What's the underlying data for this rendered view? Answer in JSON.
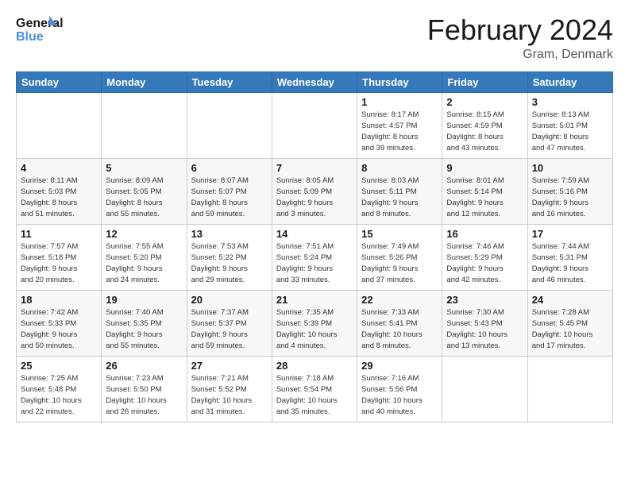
{
  "logo": {
    "line1": "General",
    "line2": "Blue"
  },
  "title": "February 2024",
  "location": "Gram, Denmark",
  "days_of_week": [
    "Sunday",
    "Monday",
    "Tuesday",
    "Wednesday",
    "Thursday",
    "Friday",
    "Saturday"
  ],
  "weeks": [
    [
      {
        "day": "",
        "info": ""
      },
      {
        "day": "",
        "info": ""
      },
      {
        "day": "",
        "info": ""
      },
      {
        "day": "",
        "info": ""
      },
      {
        "day": "1",
        "info": "Sunrise: 8:17 AM\nSunset: 4:57 PM\nDaylight: 8 hours\nand 39 minutes."
      },
      {
        "day": "2",
        "info": "Sunrise: 8:15 AM\nSunset: 4:59 PM\nDaylight: 8 hours\nand 43 minutes."
      },
      {
        "day": "3",
        "info": "Sunrise: 8:13 AM\nSunset: 5:01 PM\nDaylight: 8 hours\nand 47 minutes."
      }
    ],
    [
      {
        "day": "4",
        "info": "Sunrise: 8:11 AM\nSunset: 5:03 PM\nDaylight: 8 hours\nand 51 minutes."
      },
      {
        "day": "5",
        "info": "Sunrise: 8:09 AM\nSunset: 5:05 PM\nDaylight: 8 hours\nand 55 minutes."
      },
      {
        "day": "6",
        "info": "Sunrise: 8:07 AM\nSunset: 5:07 PM\nDaylight: 8 hours\nand 59 minutes."
      },
      {
        "day": "7",
        "info": "Sunrise: 8:05 AM\nSunset: 5:09 PM\nDaylight: 9 hours\nand 3 minutes."
      },
      {
        "day": "8",
        "info": "Sunrise: 8:03 AM\nSunset: 5:11 PM\nDaylight: 9 hours\nand 8 minutes."
      },
      {
        "day": "9",
        "info": "Sunrise: 8:01 AM\nSunset: 5:14 PM\nDaylight: 9 hours\nand 12 minutes."
      },
      {
        "day": "10",
        "info": "Sunrise: 7:59 AM\nSunset: 5:16 PM\nDaylight: 9 hours\nand 16 minutes."
      }
    ],
    [
      {
        "day": "11",
        "info": "Sunrise: 7:57 AM\nSunset: 5:18 PM\nDaylight: 9 hours\nand 20 minutes."
      },
      {
        "day": "12",
        "info": "Sunrise: 7:55 AM\nSunset: 5:20 PM\nDaylight: 9 hours\nand 24 minutes."
      },
      {
        "day": "13",
        "info": "Sunrise: 7:53 AM\nSunset: 5:22 PM\nDaylight: 9 hours\nand 29 minutes."
      },
      {
        "day": "14",
        "info": "Sunrise: 7:51 AM\nSunset: 5:24 PM\nDaylight: 9 hours\nand 33 minutes."
      },
      {
        "day": "15",
        "info": "Sunrise: 7:49 AM\nSunset: 5:26 PM\nDaylight: 9 hours\nand 37 minutes."
      },
      {
        "day": "16",
        "info": "Sunrise: 7:46 AM\nSunset: 5:29 PM\nDaylight: 9 hours\nand 42 minutes."
      },
      {
        "day": "17",
        "info": "Sunrise: 7:44 AM\nSunset: 5:31 PM\nDaylight: 9 hours\nand 46 minutes."
      }
    ],
    [
      {
        "day": "18",
        "info": "Sunrise: 7:42 AM\nSunset: 5:33 PM\nDaylight: 9 hours\nand 50 minutes."
      },
      {
        "day": "19",
        "info": "Sunrise: 7:40 AM\nSunset: 5:35 PM\nDaylight: 9 hours\nand 55 minutes."
      },
      {
        "day": "20",
        "info": "Sunrise: 7:37 AM\nSunset: 5:37 PM\nDaylight: 9 hours\nand 59 minutes."
      },
      {
        "day": "21",
        "info": "Sunrise: 7:35 AM\nSunset: 5:39 PM\nDaylight: 10 hours\nand 4 minutes."
      },
      {
        "day": "22",
        "info": "Sunrise: 7:33 AM\nSunset: 5:41 PM\nDaylight: 10 hours\nand 8 minutes."
      },
      {
        "day": "23",
        "info": "Sunrise: 7:30 AM\nSunset: 5:43 PM\nDaylight: 10 hours\nand 13 minutes."
      },
      {
        "day": "24",
        "info": "Sunrise: 7:28 AM\nSunset: 5:45 PM\nDaylight: 10 hours\nand 17 minutes."
      }
    ],
    [
      {
        "day": "25",
        "info": "Sunrise: 7:25 AM\nSunset: 5:48 PM\nDaylight: 10 hours\nand 22 minutes."
      },
      {
        "day": "26",
        "info": "Sunrise: 7:23 AM\nSunset: 5:50 PM\nDaylight: 10 hours\nand 26 minutes."
      },
      {
        "day": "27",
        "info": "Sunrise: 7:21 AM\nSunset: 5:52 PM\nDaylight: 10 hours\nand 31 minutes."
      },
      {
        "day": "28",
        "info": "Sunrise: 7:18 AM\nSunset: 5:54 PM\nDaylight: 10 hours\nand 35 minutes."
      },
      {
        "day": "29",
        "info": "Sunrise: 7:16 AM\nSunset: 5:56 PM\nDaylight: 10 hours\nand 40 minutes."
      },
      {
        "day": "",
        "info": ""
      },
      {
        "day": "",
        "info": ""
      }
    ]
  ]
}
